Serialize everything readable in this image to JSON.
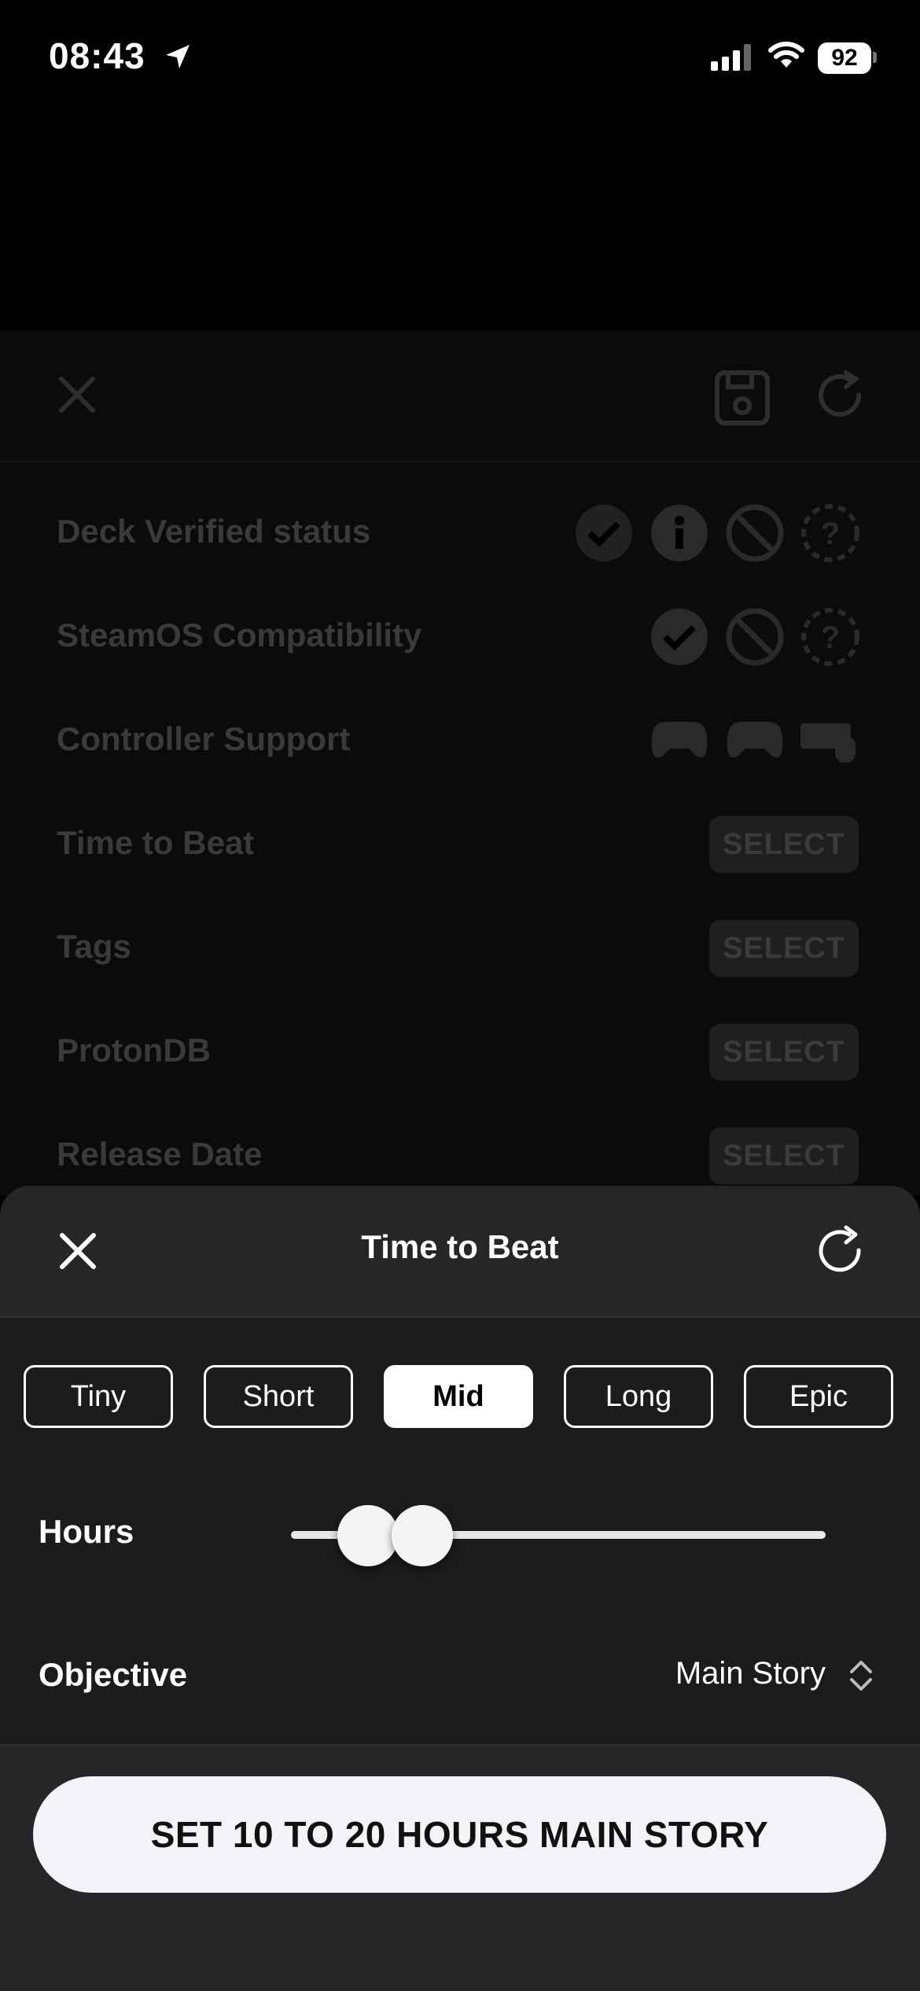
{
  "status_bar": {
    "time": "08:43",
    "battery": "92"
  },
  "background": {
    "rows": [
      {
        "label": "Deck Verified status",
        "icons": [
          "verified-check-icon",
          "info-icon",
          "unsupported-icon",
          "unknown-icon"
        ]
      },
      {
        "label": "SteamOS Compatibility",
        "icons": [
          "verified-check-icon",
          "unsupported-icon",
          "unknown-icon"
        ]
      },
      {
        "label": "Controller Support",
        "icons": [
          "gamepad-full-icon",
          "gamepad-partial-icon",
          "keyboard-mouse-icon"
        ]
      },
      {
        "label": "Time to Beat",
        "action": "SELECT"
      },
      {
        "label": "Tags",
        "action": "SELECT"
      },
      {
        "label": "ProtonDB",
        "action": "SELECT"
      },
      {
        "label": "Release Date",
        "action": "SELECT"
      }
    ]
  },
  "sheet": {
    "title": "Time to Beat",
    "segments": [
      {
        "label": "Tiny",
        "active": false
      },
      {
        "label": "Short",
        "active": false
      },
      {
        "label": "Mid",
        "active": true
      },
      {
        "label": "Long",
        "active": false
      },
      {
        "label": "Epic",
        "active": false
      }
    ],
    "hours_label": "Hours",
    "hours_range": {
      "low_fraction": 0.1,
      "high_fraction": 0.2
    },
    "objective_label": "Objective",
    "objective_value": "Main Story",
    "cta_label": "SET 10 TO 20 HOURS MAIN STORY"
  },
  "colors": {
    "sheet_bg": "#1c1c1e",
    "header_bg": "#262628",
    "accent": "#ffffff"
  }
}
